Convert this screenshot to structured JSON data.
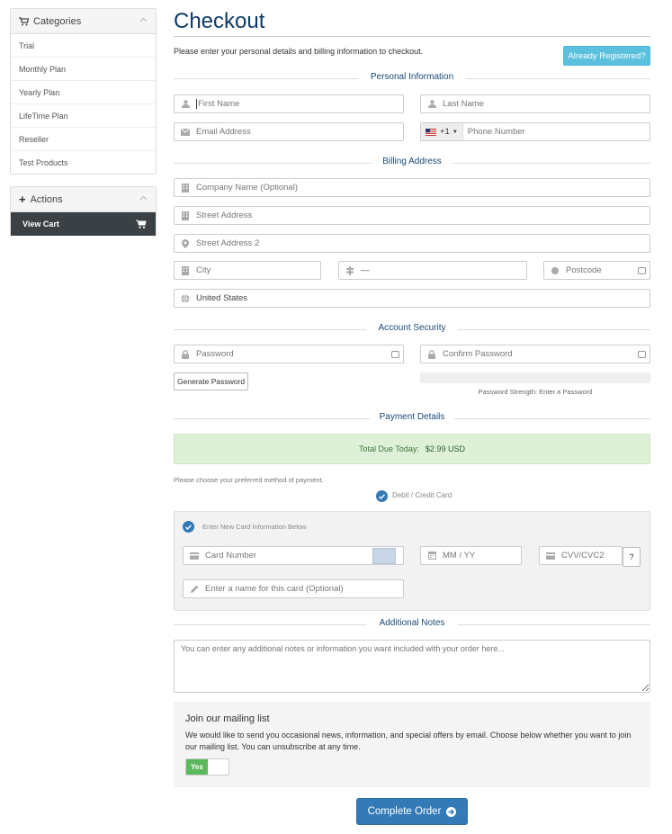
{
  "sidebar": {
    "categories_title": "Categories",
    "categories": [
      "Trial",
      "Monthly Plan",
      "Yearly Plan",
      "LifeTime Plan",
      "Reseller",
      "Test Products"
    ],
    "actions_title": "Actions",
    "view_cart": "View Cart"
  },
  "page": {
    "title": "Checkout",
    "intro": "Please enter your personal details and billing information to checkout.",
    "already_registered": "Already Registered?"
  },
  "personal": {
    "heading": "Personal Information",
    "first_name": "First Name",
    "last_name": "Last Name",
    "email": "Email Address",
    "phone_code": "+1",
    "phone": "Phone Number"
  },
  "billing": {
    "heading": "Billing Address",
    "company": "Company Name (Optional)",
    "street": "Street Address",
    "street2": "Street Address 2",
    "city": "City",
    "state": "—",
    "postcode": "Postcode",
    "country": "United States"
  },
  "security": {
    "heading": "Account Security",
    "password": "Password",
    "confirm": "Confirm Password",
    "generate": "Generate Password",
    "strength": "Password Strength: Enter a Password"
  },
  "payment": {
    "heading": "Payment Details",
    "total_label": "Total Due Today:",
    "total_value": "$2.99 USD",
    "choose": "Please choose your preferred method of payment.",
    "method": "Debit / Credit Card",
    "new_card": "Enter New Card Information Below",
    "card_number": "Card Number",
    "expiry": "MM / YY",
    "cvv": "CVV/CVC2",
    "cvv_help": "?",
    "card_name": "Enter a name for this card (Optional)"
  },
  "notes": {
    "heading": "Additional Notes",
    "placeholder": "You can enter any additional notes or information you want included with your order here..."
  },
  "mailing": {
    "title": "Join our mailing list",
    "text": "We would like to send you occasional news, information, and special offers by email. Choose below whether you want to join our mailing list. You can unsubscribe at any time.",
    "toggle": "Yes"
  },
  "complete": "Complete Order",
  "colors": {
    "accent": "#337ab7",
    "title": "#0d3b66",
    "success_bg": "#dff0d8",
    "toggle_on": "#5cb85c",
    "sidebar_active": "#3b4044",
    "info": "#5bc0de"
  }
}
